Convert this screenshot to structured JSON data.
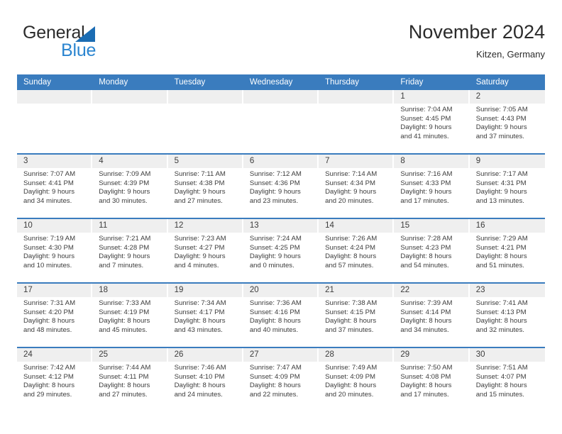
{
  "logo": {
    "word_one": "General",
    "word_two": "Blue",
    "triangle_icon": "blue-triangle-icon",
    "accent_dark": "#2b2b2b",
    "accent_blue": "#2b85d0",
    "triangle_color": "#1b6cb3"
  },
  "header": {
    "month_title": "November 2024",
    "location": "Kitzen, Germany"
  },
  "theme": {
    "header_blue": "#3a7cbe",
    "day_band_gray": "#efefef",
    "text_color": "#3c3c3c"
  },
  "weekdays": [
    "Sunday",
    "Monday",
    "Tuesday",
    "Wednesday",
    "Thursday",
    "Friday",
    "Saturday"
  ],
  "weeks": [
    [
      {
        "day": "",
        "sunrise": "",
        "sunset": "",
        "daylight_1": "",
        "daylight_2": ""
      },
      {
        "day": "",
        "sunrise": "",
        "sunset": "",
        "daylight_1": "",
        "daylight_2": ""
      },
      {
        "day": "",
        "sunrise": "",
        "sunset": "",
        "daylight_1": "",
        "daylight_2": ""
      },
      {
        "day": "",
        "sunrise": "",
        "sunset": "",
        "daylight_1": "",
        "daylight_2": ""
      },
      {
        "day": "",
        "sunrise": "",
        "sunset": "",
        "daylight_1": "",
        "daylight_2": ""
      },
      {
        "day": "1",
        "sunrise": "Sunrise: 7:04 AM",
        "sunset": "Sunset: 4:45 PM",
        "daylight_1": "Daylight: 9 hours",
        "daylight_2": "and 41 minutes."
      },
      {
        "day": "2",
        "sunrise": "Sunrise: 7:05 AM",
        "sunset": "Sunset: 4:43 PM",
        "daylight_1": "Daylight: 9 hours",
        "daylight_2": "and 37 minutes."
      }
    ],
    [
      {
        "day": "3",
        "sunrise": "Sunrise: 7:07 AM",
        "sunset": "Sunset: 4:41 PM",
        "daylight_1": "Daylight: 9 hours",
        "daylight_2": "and 34 minutes."
      },
      {
        "day": "4",
        "sunrise": "Sunrise: 7:09 AM",
        "sunset": "Sunset: 4:39 PM",
        "daylight_1": "Daylight: 9 hours",
        "daylight_2": "and 30 minutes."
      },
      {
        "day": "5",
        "sunrise": "Sunrise: 7:11 AM",
        "sunset": "Sunset: 4:38 PM",
        "daylight_1": "Daylight: 9 hours",
        "daylight_2": "and 27 minutes."
      },
      {
        "day": "6",
        "sunrise": "Sunrise: 7:12 AM",
        "sunset": "Sunset: 4:36 PM",
        "daylight_1": "Daylight: 9 hours",
        "daylight_2": "and 23 minutes."
      },
      {
        "day": "7",
        "sunrise": "Sunrise: 7:14 AM",
        "sunset": "Sunset: 4:34 PM",
        "daylight_1": "Daylight: 9 hours",
        "daylight_2": "and 20 minutes."
      },
      {
        "day": "8",
        "sunrise": "Sunrise: 7:16 AM",
        "sunset": "Sunset: 4:33 PM",
        "daylight_1": "Daylight: 9 hours",
        "daylight_2": "and 17 minutes."
      },
      {
        "day": "9",
        "sunrise": "Sunrise: 7:17 AM",
        "sunset": "Sunset: 4:31 PM",
        "daylight_1": "Daylight: 9 hours",
        "daylight_2": "and 13 minutes."
      }
    ],
    [
      {
        "day": "10",
        "sunrise": "Sunrise: 7:19 AM",
        "sunset": "Sunset: 4:30 PM",
        "daylight_1": "Daylight: 9 hours",
        "daylight_2": "and 10 minutes."
      },
      {
        "day": "11",
        "sunrise": "Sunrise: 7:21 AM",
        "sunset": "Sunset: 4:28 PM",
        "daylight_1": "Daylight: 9 hours",
        "daylight_2": "and 7 minutes."
      },
      {
        "day": "12",
        "sunrise": "Sunrise: 7:23 AM",
        "sunset": "Sunset: 4:27 PM",
        "daylight_1": "Daylight: 9 hours",
        "daylight_2": "and 4 minutes."
      },
      {
        "day": "13",
        "sunrise": "Sunrise: 7:24 AM",
        "sunset": "Sunset: 4:25 PM",
        "daylight_1": "Daylight: 9 hours",
        "daylight_2": "and 0 minutes."
      },
      {
        "day": "14",
        "sunrise": "Sunrise: 7:26 AM",
        "sunset": "Sunset: 4:24 PM",
        "daylight_1": "Daylight: 8 hours",
        "daylight_2": "and 57 minutes."
      },
      {
        "day": "15",
        "sunrise": "Sunrise: 7:28 AM",
        "sunset": "Sunset: 4:23 PM",
        "daylight_1": "Daylight: 8 hours",
        "daylight_2": "and 54 minutes."
      },
      {
        "day": "16",
        "sunrise": "Sunrise: 7:29 AM",
        "sunset": "Sunset: 4:21 PM",
        "daylight_1": "Daylight: 8 hours",
        "daylight_2": "and 51 minutes."
      }
    ],
    [
      {
        "day": "17",
        "sunrise": "Sunrise: 7:31 AM",
        "sunset": "Sunset: 4:20 PM",
        "daylight_1": "Daylight: 8 hours",
        "daylight_2": "and 48 minutes."
      },
      {
        "day": "18",
        "sunrise": "Sunrise: 7:33 AM",
        "sunset": "Sunset: 4:19 PM",
        "daylight_1": "Daylight: 8 hours",
        "daylight_2": "and 45 minutes."
      },
      {
        "day": "19",
        "sunrise": "Sunrise: 7:34 AM",
        "sunset": "Sunset: 4:17 PM",
        "daylight_1": "Daylight: 8 hours",
        "daylight_2": "and 43 minutes."
      },
      {
        "day": "20",
        "sunrise": "Sunrise: 7:36 AM",
        "sunset": "Sunset: 4:16 PM",
        "daylight_1": "Daylight: 8 hours",
        "daylight_2": "and 40 minutes."
      },
      {
        "day": "21",
        "sunrise": "Sunrise: 7:38 AM",
        "sunset": "Sunset: 4:15 PM",
        "daylight_1": "Daylight: 8 hours",
        "daylight_2": "and 37 minutes."
      },
      {
        "day": "22",
        "sunrise": "Sunrise: 7:39 AM",
        "sunset": "Sunset: 4:14 PM",
        "daylight_1": "Daylight: 8 hours",
        "daylight_2": "and 34 minutes."
      },
      {
        "day": "23",
        "sunrise": "Sunrise: 7:41 AM",
        "sunset": "Sunset: 4:13 PM",
        "daylight_1": "Daylight: 8 hours",
        "daylight_2": "and 32 minutes."
      }
    ],
    [
      {
        "day": "24",
        "sunrise": "Sunrise: 7:42 AM",
        "sunset": "Sunset: 4:12 PM",
        "daylight_1": "Daylight: 8 hours",
        "daylight_2": "and 29 minutes."
      },
      {
        "day": "25",
        "sunrise": "Sunrise: 7:44 AM",
        "sunset": "Sunset: 4:11 PM",
        "daylight_1": "Daylight: 8 hours",
        "daylight_2": "and 27 minutes."
      },
      {
        "day": "26",
        "sunrise": "Sunrise: 7:46 AM",
        "sunset": "Sunset: 4:10 PM",
        "daylight_1": "Daylight: 8 hours",
        "daylight_2": "and 24 minutes."
      },
      {
        "day": "27",
        "sunrise": "Sunrise: 7:47 AM",
        "sunset": "Sunset: 4:09 PM",
        "daylight_1": "Daylight: 8 hours",
        "daylight_2": "and 22 minutes."
      },
      {
        "day": "28",
        "sunrise": "Sunrise: 7:49 AM",
        "sunset": "Sunset: 4:09 PM",
        "daylight_1": "Daylight: 8 hours",
        "daylight_2": "and 20 minutes."
      },
      {
        "day": "29",
        "sunrise": "Sunrise: 7:50 AM",
        "sunset": "Sunset: 4:08 PM",
        "daylight_1": "Daylight: 8 hours",
        "daylight_2": "and 17 minutes."
      },
      {
        "day": "30",
        "sunrise": "Sunrise: 7:51 AM",
        "sunset": "Sunset: 4:07 PM",
        "daylight_1": "Daylight: 8 hours",
        "daylight_2": "and 15 minutes."
      }
    ]
  ]
}
